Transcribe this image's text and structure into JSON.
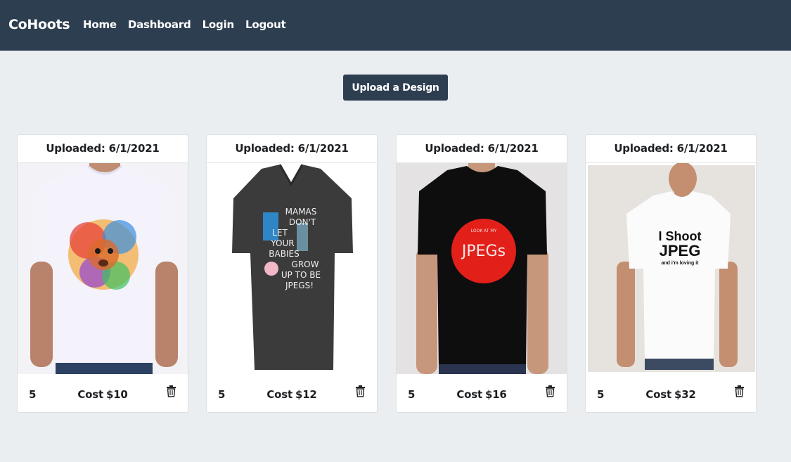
{
  "nav": {
    "brand": "CoHoots",
    "links": [
      "Home",
      "Dashboard",
      "Login",
      "Logout"
    ]
  },
  "upload_button": "Upload a Design",
  "cards": [
    {
      "uploaded": "Uploaded: 6/1/2021",
      "quantity": "5",
      "cost_label": "Cost",
      "cost_value": "$10",
      "image": "white t-shirt with colorful lion print"
    },
    {
      "uploaded": "Uploaded: 6/1/2021",
      "quantity": "5",
      "cost_label": "Cost",
      "cost_value": "$12",
      "image": "grey v-neck t-shirt with text print",
      "shirt_text": [
        "MAMAS",
        "DON'T",
        "LET",
        "YOUR",
        "BABIES",
        "GROW",
        "UP TO BE",
        "JPEGS!"
      ]
    },
    {
      "uploaded": "Uploaded: 6/1/2021",
      "quantity": "5",
      "cost_label": "Cost",
      "cost_value": "$16",
      "image": "black t-shirt with red circle print",
      "shirt_small": "LOOK AT MY",
      "shirt_text": "JPEGs"
    },
    {
      "uploaded": "Uploaded: 6/1/2021",
      "quantity": "5",
      "cost_label": "Cost",
      "cost_value": "$32",
      "image": "white t-shirt with text print",
      "shirt_line1": "I Shoot",
      "shirt_line2": "JPEG",
      "shirt_line3": "and i'm loving it"
    }
  ],
  "colors": {
    "navbar": "#2e3e51",
    "page_bg": "#ebeef0",
    "card_bg": "#ffffff"
  }
}
